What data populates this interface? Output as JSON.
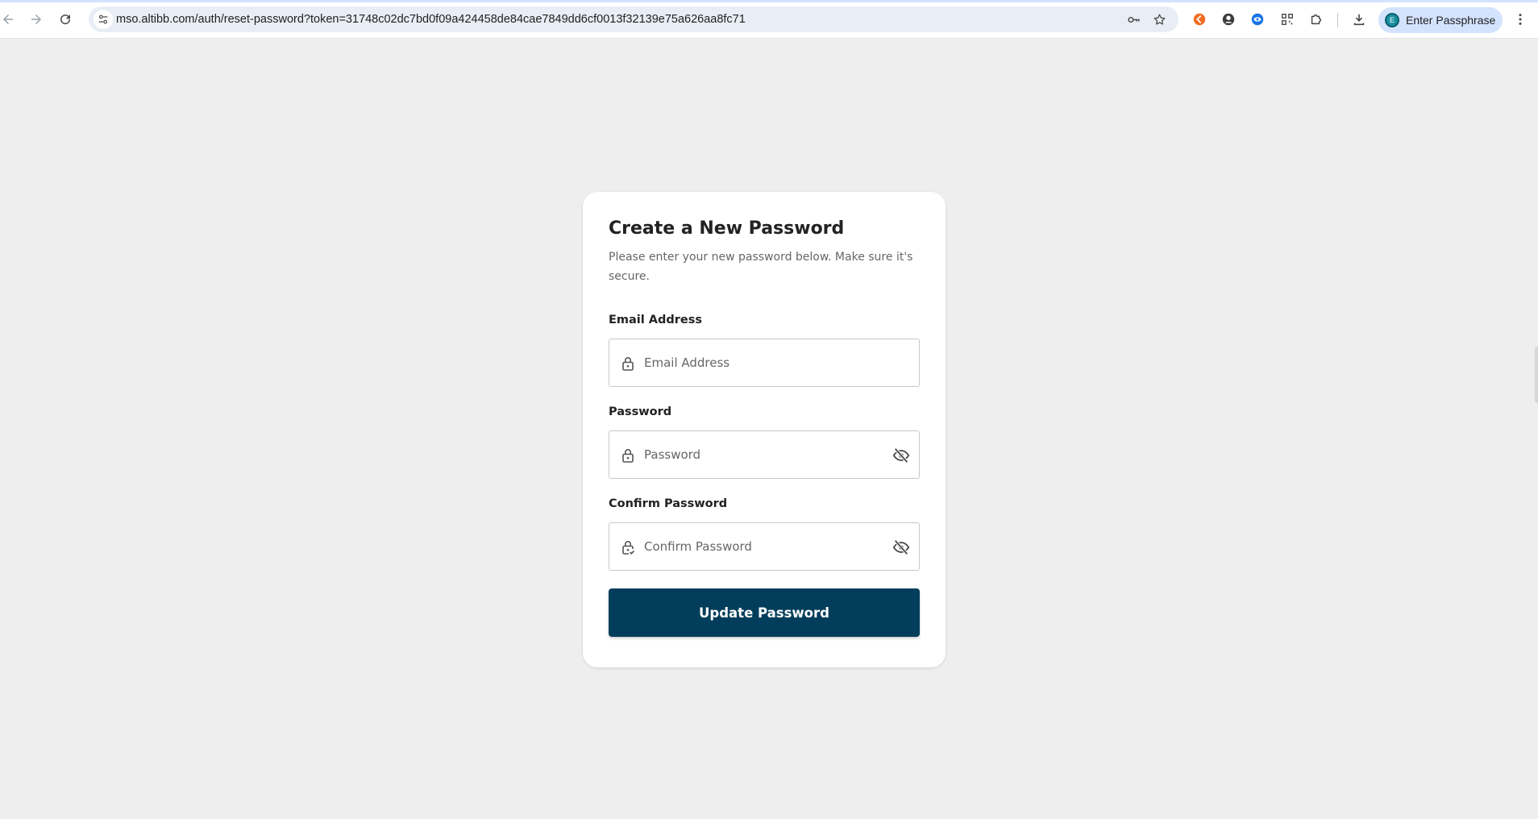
{
  "browser": {
    "url": "mso.altibb.com/auth/reset-password?token=31748c02dc7bd0f09a424458de84cae7849dd6cf0013f32139e75a626aa8fc71",
    "profile_label": "Enter Passphrase",
    "profile_initial": "E",
    "icons": {
      "back": "back-arrow-icon",
      "forward": "forward-arrow-icon",
      "reload": "reload-icon",
      "site_settings": "tune-icon",
      "passwords": "key-icon",
      "bookmark": "star-icon",
      "extensions": [
        "orange-extension-icon",
        "account-extension-icon",
        "blue-eye-extension-icon",
        "qr-extension-icon",
        "puzzle-icon"
      ],
      "downloads": "download-icon",
      "menu": "kebab-menu-icon"
    }
  },
  "form": {
    "title": "Create a New Password",
    "subtitle": "Please enter your new password below. Make sure it's secure.",
    "email": {
      "label": "Email Address",
      "placeholder": "Email Address",
      "value": "",
      "icon": "lock-icon"
    },
    "password": {
      "label": "Password",
      "placeholder": "Password",
      "value": "",
      "icon": "lock-icon",
      "toggle_icon": "eye-off-icon"
    },
    "confirm_password": {
      "label": "Confirm Password",
      "placeholder": "Confirm Password",
      "value": "",
      "icon": "lock-check-icon",
      "toggle_icon": "eye-off-icon"
    },
    "submit_label": "Update Password"
  },
  "colors": {
    "page_background": "#eeeeee",
    "card_background": "#ffffff",
    "primary_button": "#023e5b",
    "omnibox": "#e9eef6",
    "profile_chip": "#d3e3fd"
  }
}
